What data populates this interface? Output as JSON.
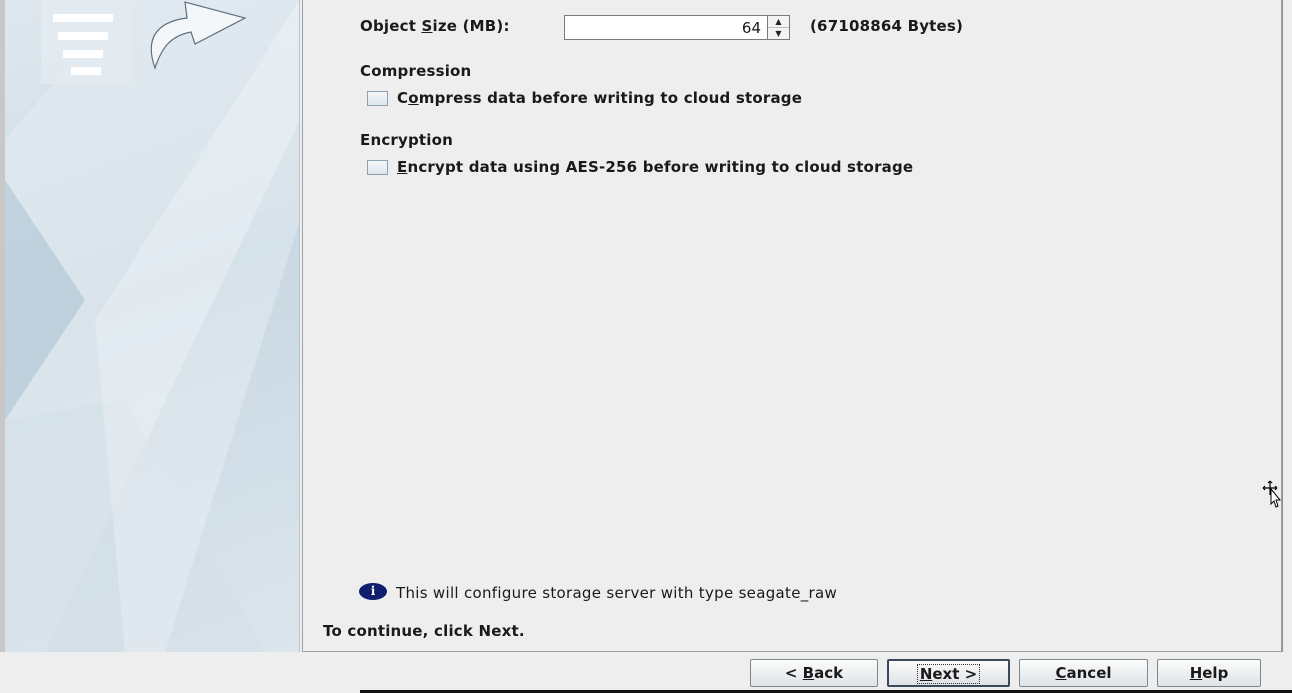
{
  "object_size": {
    "label_pre": "Object ",
    "label_mnemonic": "S",
    "label_post": "ize (MB):",
    "value": "64",
    "bytes_text": "(67108864 Bytes)"
  },
  "compression": {
    "heading": "Compression",
    "checkbox_pre": "C",
    "checkbox_mnemonic": "o",
    "checkbox_post": "mpress data before writing to cloud storage",
    "checked": false
  },
  "encryption": {
    "heading": "Encryption",
    "checkbox_mnemonic": "E",
    "checkbox_post": "ncrypt data using AES-256 before writing to cloud storage",
    "checked": false
  },
  "info": {
    "icon": "info-icon",
    "text": "This will configure storage server with type seagate_raw"
  },
  "instruction": "To continue, click Next.",
  "buttons": {
    "back_pre": "< ",
    "back_mnemonic": "B",
    "back_post": "ack",
    "next_mnemonic": "N",
    "next_post": "ext >",
    "cancel_mnemonic": "C",
    "cancel_post": "ancel",
    "help_mnemonic": "H",
    "help_post": "elp"
  },
  "colors": {
    "background": "#eeeeee",
    "sidebar_blue": "#c9d8e3",
    "info_icon": "#0f1f6d"
  }
}
